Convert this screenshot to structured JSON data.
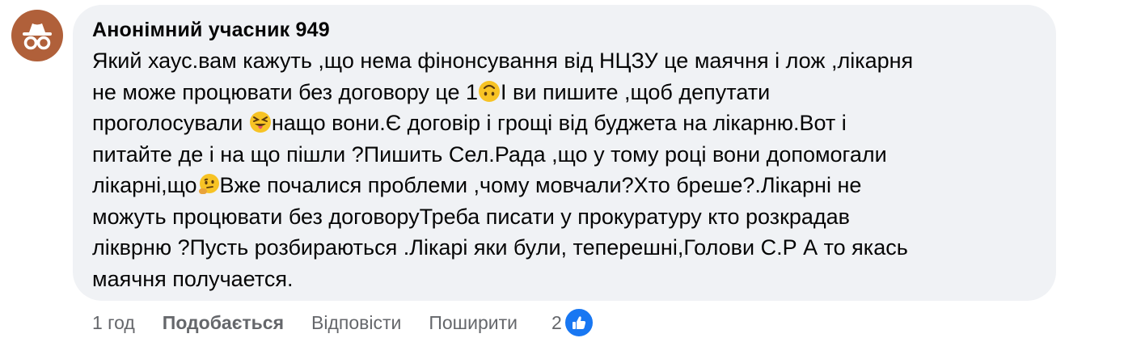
{
  "comment": {
    "author": "Анонімний учасник 949",
    "lines": [
      [
        "Який хаус.вам кажуть ,що нема фінонсування від НЦЗУ це маячня і лож ,лікарня"
      ],
      [
        "не може процювати без договору це 1",
        "І ви пишите ,щоб депутати"
      ],
      [
        "проголосували ",
        "нащо вони.Є договір і грощі від буджета на лікарню.Вот і"
      ],
      [
        "питайте де і на що пішли ?Пишить Сел.Рада ,що у тому році вони допомогали"
      ],
      [
        "лікарні,що",
        "Вже почалися проблеми ,чому мовчали?Хто бреше?.Лікарні не"
      ],
      [
        "можуть процювати без договоруТреба писати у прокуратуру кто розкрадав"
      ],
      [
        "лікврню ?Пусть розбираються .Лікарі яки були, теперешні,Голови С.Р А то якась"
      ],
      [
        "маячня получается."
      ]
    ],
    "emojis": [
      "upside-down-face",
      "squinting-tongue-face",
      "thinking-face"
    ]
  },
  "actions": {
    "time": "1 год",
    "like_label": "Подобається",
    "reply_label": "Відповісти",
    "share_label": "Поширити",
    "reaction_count": "2"
  },
  "colors": {
    "bubble": "#f0f2f5",
    "avatar": "#b0603a",
    "like_blue": "#1877f2",
    "meta_gray": "#65676b"
  },
  "icons": {
    "avatar": "incognito-icon",
    "reaction": "thumbs-up-icon"
  }
}
